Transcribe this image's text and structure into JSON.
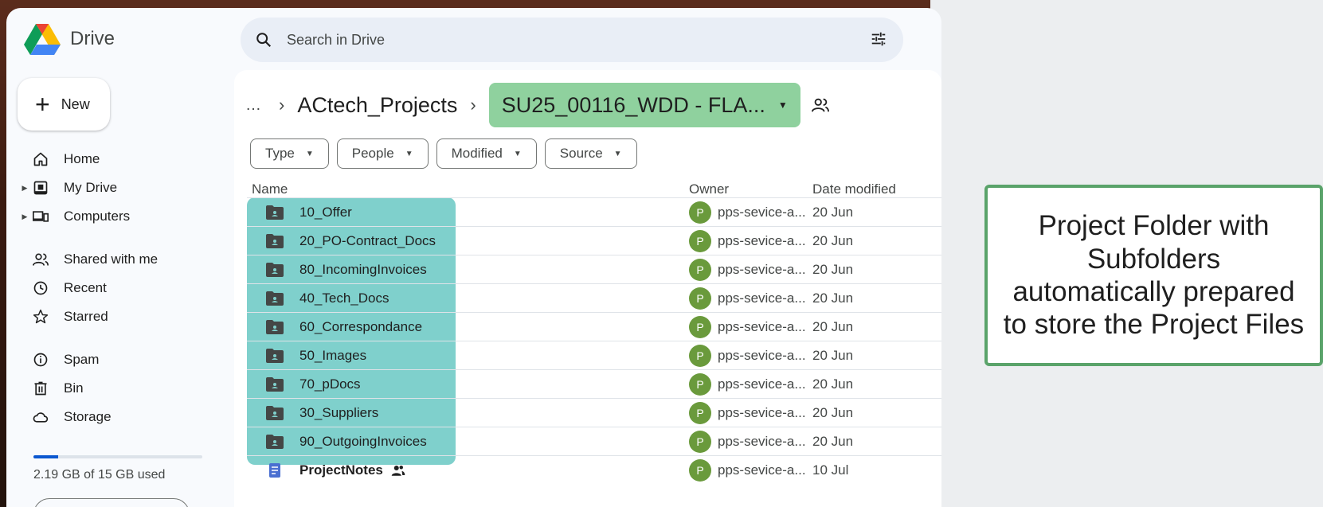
{
  "app": {
    "name": "Drive"
  },
  "sidebar": {
    "new_label": "New",
    "nav": [
      {
        "label": "Home",
        "icon": "home-icon"
      },
      {
        "label": "My Drive",
        "icon": "my-drive-icon"
      },
      {
        "label": "Computers",
        "icon": "computers-icon"
      },
      {
        "label": "Shared with me",
        "icon": "people-icon"
      },
      {
        "label": "Recent",
        "icon": "clock-icon"
      },
      {
        "label": "Starred",
        "icon": "star-icon"
      },
      {
        "label": "Spam",
        "icon": "spam-icon"
      },
      {
        "label": "Bin",
        "icon": "trash-icon"
      },
      {
        "label": "Storage",
        "icon": "cloud-icon"
      }
    ],
    "storage_text": "2.19 GB of 15 GB used",
    "storage_fraction": 0.146
  },
  "search": {
    "placeholder": "Search in Drive"
  },
  "breadcrumb": {
    "more": "…",
    "root": "ACtech_Projects",
    "current": "SU25_00116_WDD - FLA..."
  },
  "filters": [
    "Type",
    "People",
    "Modified",
    "Source"
  ],
  "table": {
    "headers": {
      "name": "Name",
      "owner": "Owner",
      "date": "Date modified"
    },
    "rows": [
      {
        "name": "10_Offer",
        "type": "folder",
        "avatar": "P",
        "owner": "pps-sevice-a...",
        "date": "20 Jun"
      },
      {
        "name": "20_PO-Contract_Docs",
        "type": "folder",
        "avatar": "P",
        "owner": "pps-sevice-a...",
        "date": "20 Jun"
      },
      {
        "name": "80_IncomingInvoices",
        "type": "folder",
        "avatar": "P",
        "owner": "pps-sevice-a...",
        "date": "20 Jun"
      },
      {
        "name": "40_Tech_Docs",
        "type": "folder",
        "avatar": "P",
        "owner": "pps-sevice-a...",
        "date": "20 Jun"
      },
      {
        "name": "60_Correspondance",
        "type": "folder",
        "avatar": "P",
        "owner": "pps-sevice-a...",
        "date": "20 Jun"
      },
      {
        "name": "50_Images",
        "type": "folder",
        "avatar": "P",
        "owner": "pps-sevice-a...",
        "date": "20 Jun"
      },
      {
        "name": "70_pDocs",
        "type": "folder",
        "avatar": "P",
        "owner": "pps-sevice-a...",
        "date": "20 Jun"
      },
      {
        "name": "30_Suppliers",
        "type": "folder",
        "avatar": "P",
        "owner": "pps-sevice-a...",
        "date": "20 Jun"
      },
      {
        "name": "90_OutgoingInvoices",
        "type": "folder",
        "avatar": "P",
        "owner": "pps-sevice-a...",
        "date": "20 Jun"
      },
      {
        "name": "ProjectNotes",
        "type": "doc",
        "avatar": "P",
        "owner": "pps-sevice-a...",
        "date": "10 Jul"
      }
    ]
  },
  "callout": {
    "text": "Project Folder with Subfolders automatically prepared to store the Project Files"
  },
  "colors": {
    "highlight_teal": "#7fd0cc",
    "breadcrumb_green": "#8fd19e",
    "callout_border": "#5aa36a",
    "avatar_green": "#6a9a3c"
  }
}
